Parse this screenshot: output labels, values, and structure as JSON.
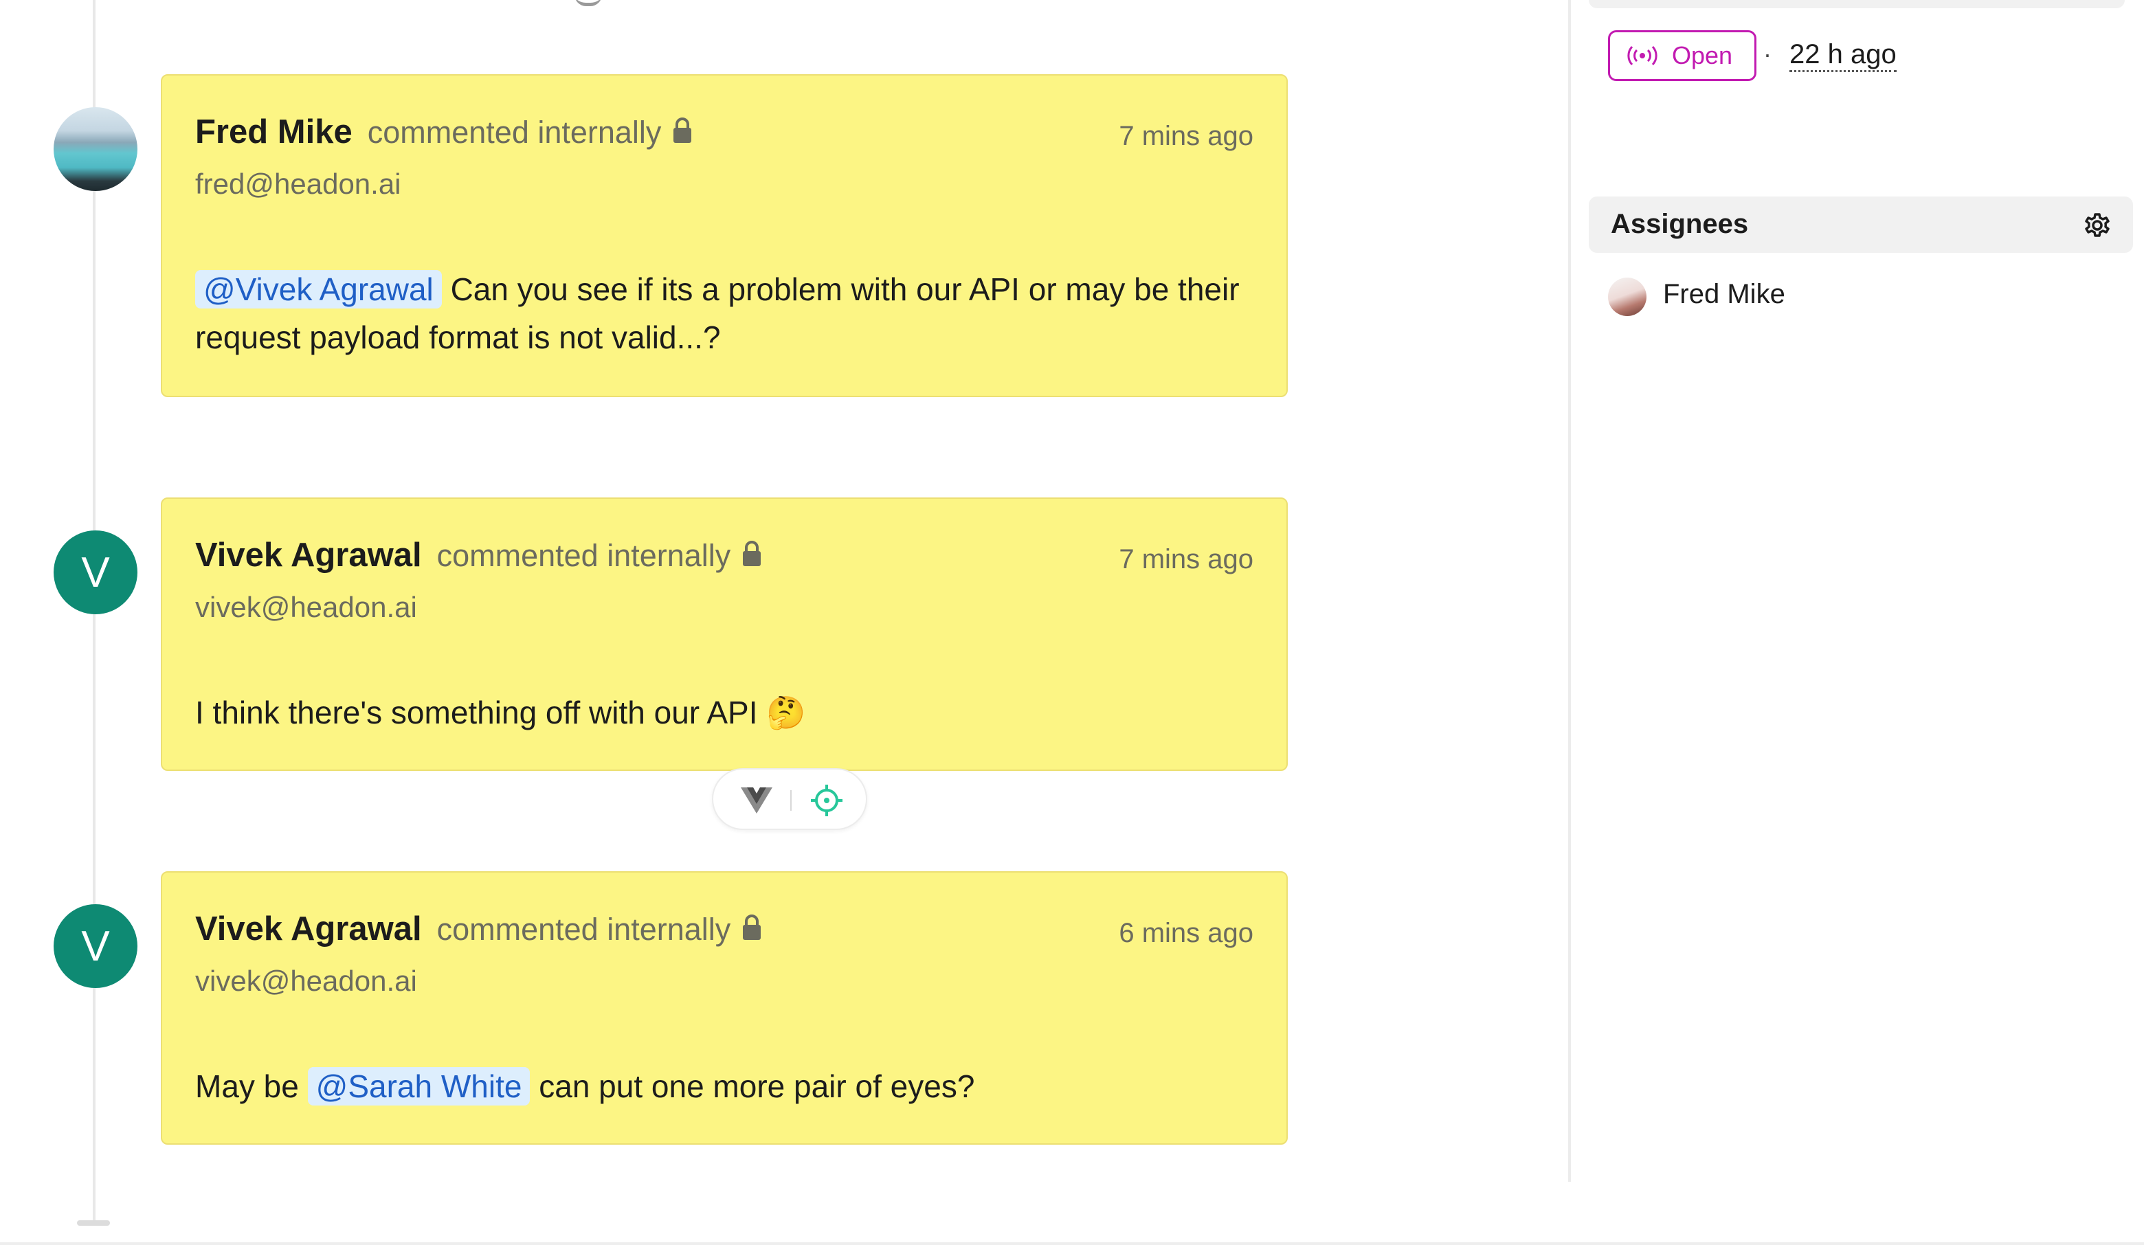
{
  "header": {
    "status_label": "Open",
    "status_color": "#c21bb1",
    "separator": "·",
    "since": "22 h ago"
  },
  "sidebar": {
    "assignees_title": "Assignees",
    "assignees": [
      {
        "name": "Fred Mike"
      }
    ]
  },
  "comments": [
    {
      "author": "Fred Mike",
      "action": "commented internally",
      "time": "7 mins ago",
      "email": "fred@headon.ai",
      "mention": "@Vivek Agrawal",
      "text_after_mention": "Can you see if its a problem with our API or may be their request payload format is not valid...?"
    },
    {
      "author": "Vivek Agrawal",
      "avatar_initial": "V",
      "action": "commented internally",
      "time": "7 mins ago",
      "email": "vivek@headon.ai",
      "text": "I think there's something off with our API 🤔"
    },
    {
      "author": "Vivek Agrawal",
      "avatar_initial": "V",
      "action": "commented internally",
      "time": "6 mins ago",
      "email": "vivek@headon.ai",
      "text_before_mention": "May be",
      "mention": "@Sarah White",
      "text_after_mention": "can put one more pair of eyes?"
    }
  ],
  "colors": {
    "card_bg": "#fcf584",
    "mention_text": "#1f5fc6",
    "mention_bg": "#ddeefd",
    "avatar_bg": "#0e8a73"
  }
}
